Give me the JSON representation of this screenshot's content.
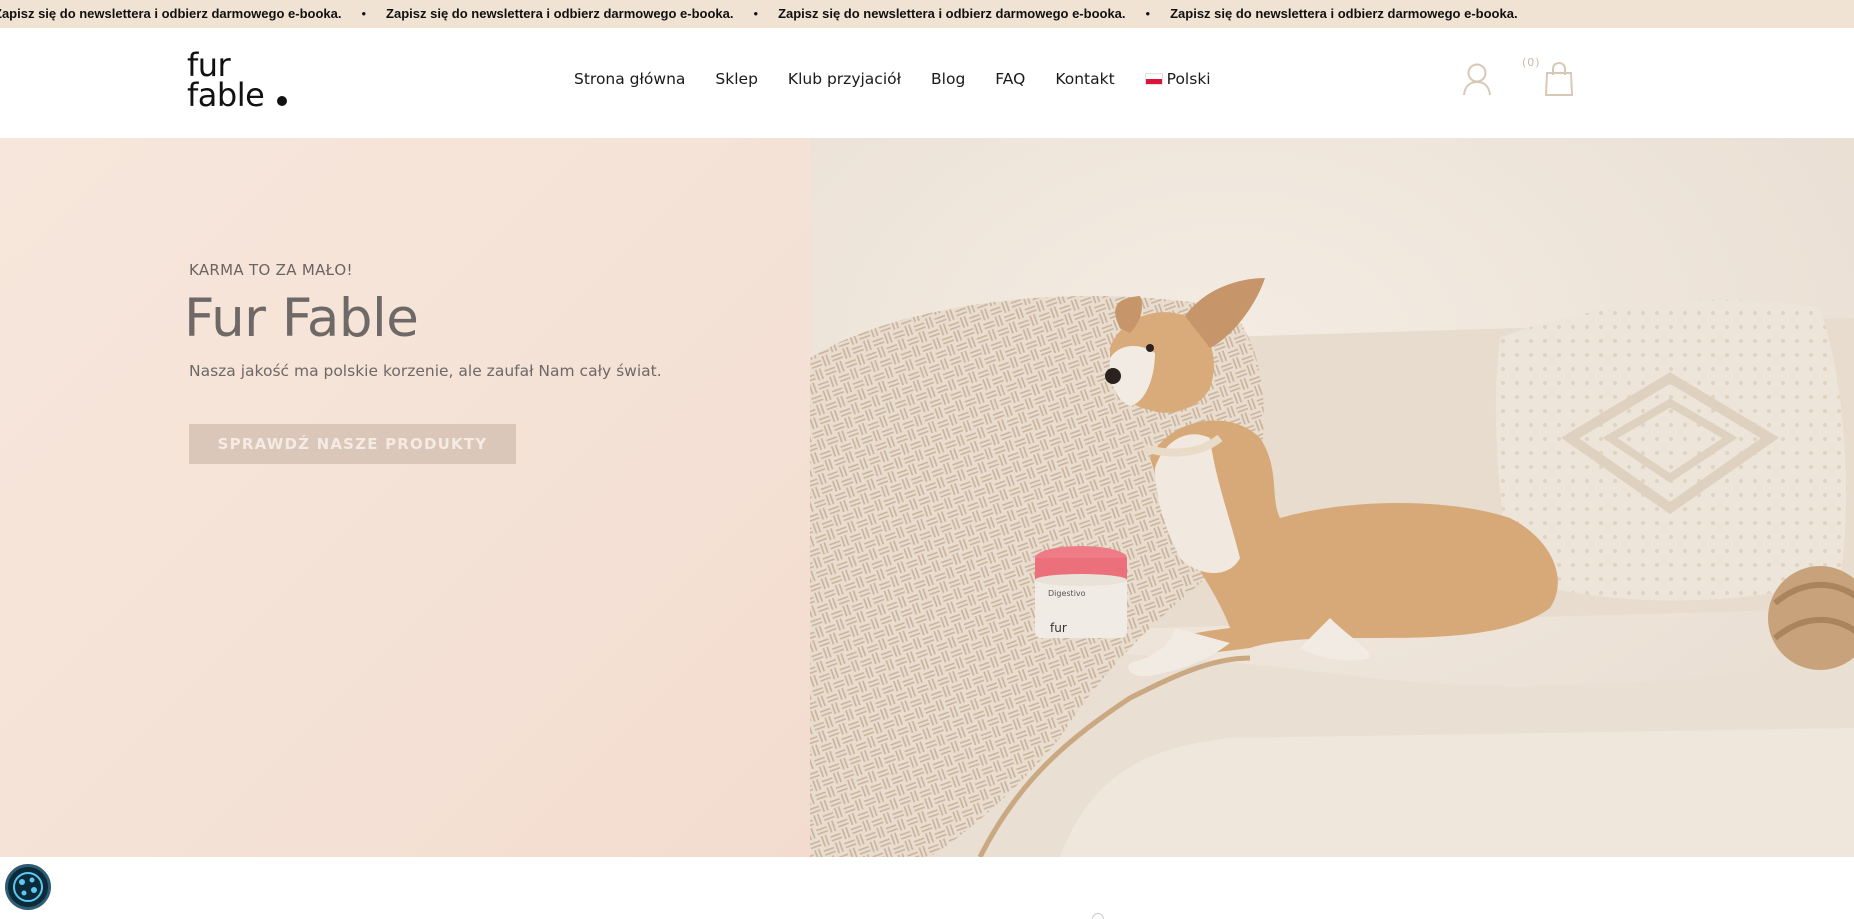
{
  "marquee": {
    "items": [
      "Zapisz się do newslettera i odbierz darmowego e-booka.",
      "Zapisz się do newslettera i odbierz darmowego e-booka.",
      "Zapisz się do newslettera i odbierz darmowego e-booka.",
      "Zapisz się do newslettera i odbierz darmowego e-booka."
    ],
    "separator": "•"
  },
  "header": {
    "logo_line1": "fur",
    "logo_line2": "fable",
    "nav": [
      "Strona główna",
      "Sklep",
      "Klub przyjaciół",
      "Blog",
      "FAQ",
      "Kontakt"
    ],
    "language": "Polski",
    "cart_count": "(0)"
  },
  "hero": {
    "eyebrow": "KARMA TO ZA MAŁO!",
    "title": "Fur Fable",
    "subtitle": "Nasza jakość ma polskie korzenie, ale zaufał Nam cały świat.",
    "cta": "SPRAWDŹ NASZE PRODUKTY",
    "product_label_brand": "fur",
    "product_label_name": "Digestivo"
  },
  "colors": {
    "marquee_bg": "#f1e3d3",
    "hero_left_bg": "#f5e3d8",
    "cta_bg": "#dac7b9",
    "icon_stroke": "#d8c8b8",
    "cookie_bg": "#0b2a3a"
  },
  "icons": [
    "user-icon",
    "shopping-bag-icon",
    "cookie-settings-icon",
    "poland-flag-icon"
  ]
}
